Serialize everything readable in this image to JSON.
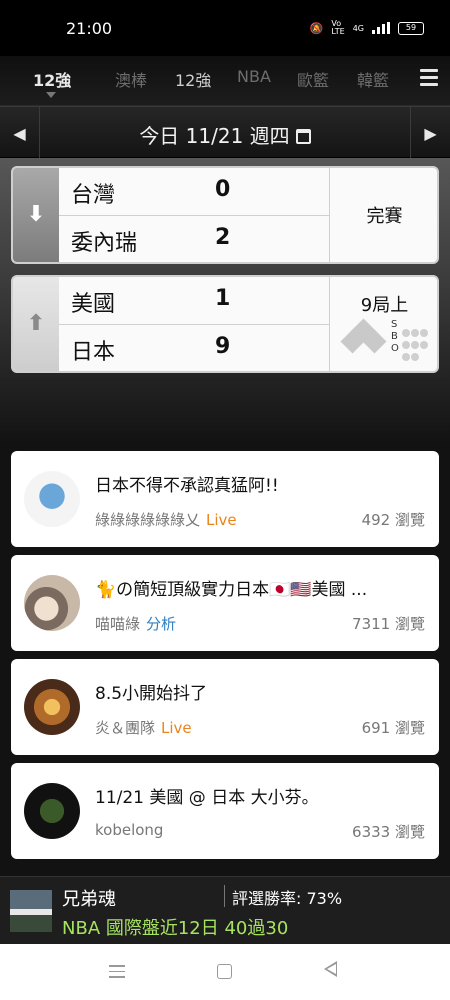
{
  "status_bar": {
    "time": "21:00",
    "network_label": "4G",
    "battery": "59"
  },
  "tabs": [
    {
      "label": "12強",
      "active": true
    },
    {
      "label": "澳棒",
      "active": false
    },
    {
      "label": "12強",
      "active": false,
      "highlight": true
    },
    {
      "label": "NBA",
      "active": false
    },
    {
      "label": "歐籃",
      "active": false
    },
    {
      "label": "韓籃",
      "active": false
    }
  ],
  "date_bar": {
    "label": "今日 11/21 週四",
    "prev_icon": "chevron-left-icon",
    "next_icon": "chevron-right-icon"
  },
  "matches": [
    {
      "team1": {
        "name": "台灣",
        "score": "0"
      },
      "team2": {
        "name": "委內瑞",
        "score": "2"
      },
      "status": "完賽",
      "arrow": "down-arrow-icon"
    },
    {
      "team1": {
        "name": "美國",
        "score": "1"
      },
      "team2": {
        "name": "日本",
        "score": "9"
      },
      "status": "9局上",
      "sbo": {
        "s": "S",
        "b": "B",
        "o": "O"
      },
      "arrow": "up-arrow-icon"
    }
  ],
  "articles": [
    {
      "title": "日本不得不承認真猛阿!!",
      "author": "綠綠綠綠綠綠乂",
      "tag": "Live",
      "tag_type": "live",
      "views": "492 瀏覽"
    },
    {
      "title": "🐈の簡短頂級實力日本🇯🇵🇺🇸美國 ...",
      "author": "喵喵綠",
      "tag": "分析",
      "tag_type": "analysis",
      "views": "7311 瀏覽"
    },
    {
      "title": "8.5小開始抖了",
      "author": "炎＆團隊",
      "tag": "Live",
      "tag_type": "live",
      "views": "691 瀏覽"
    },
    {
      "title": "11/21 美國 @ 日本 大小芬。",
      "author": "kobelong",
      "tag": "",
      "tag_type": "",
      "views": "6333 瀏覽"
    }
  ],
  "promo": {
    "name": "兄弟魂",
    "rate": "評選勝率: 73%",
    "record": "NBA 國際盤近12日 40過30"
  },
  "colors": {
    "live": "#e8851e",
    "analysis": "#2f7fc2",
    "promo_record": "#a6e35f"
  }
}
